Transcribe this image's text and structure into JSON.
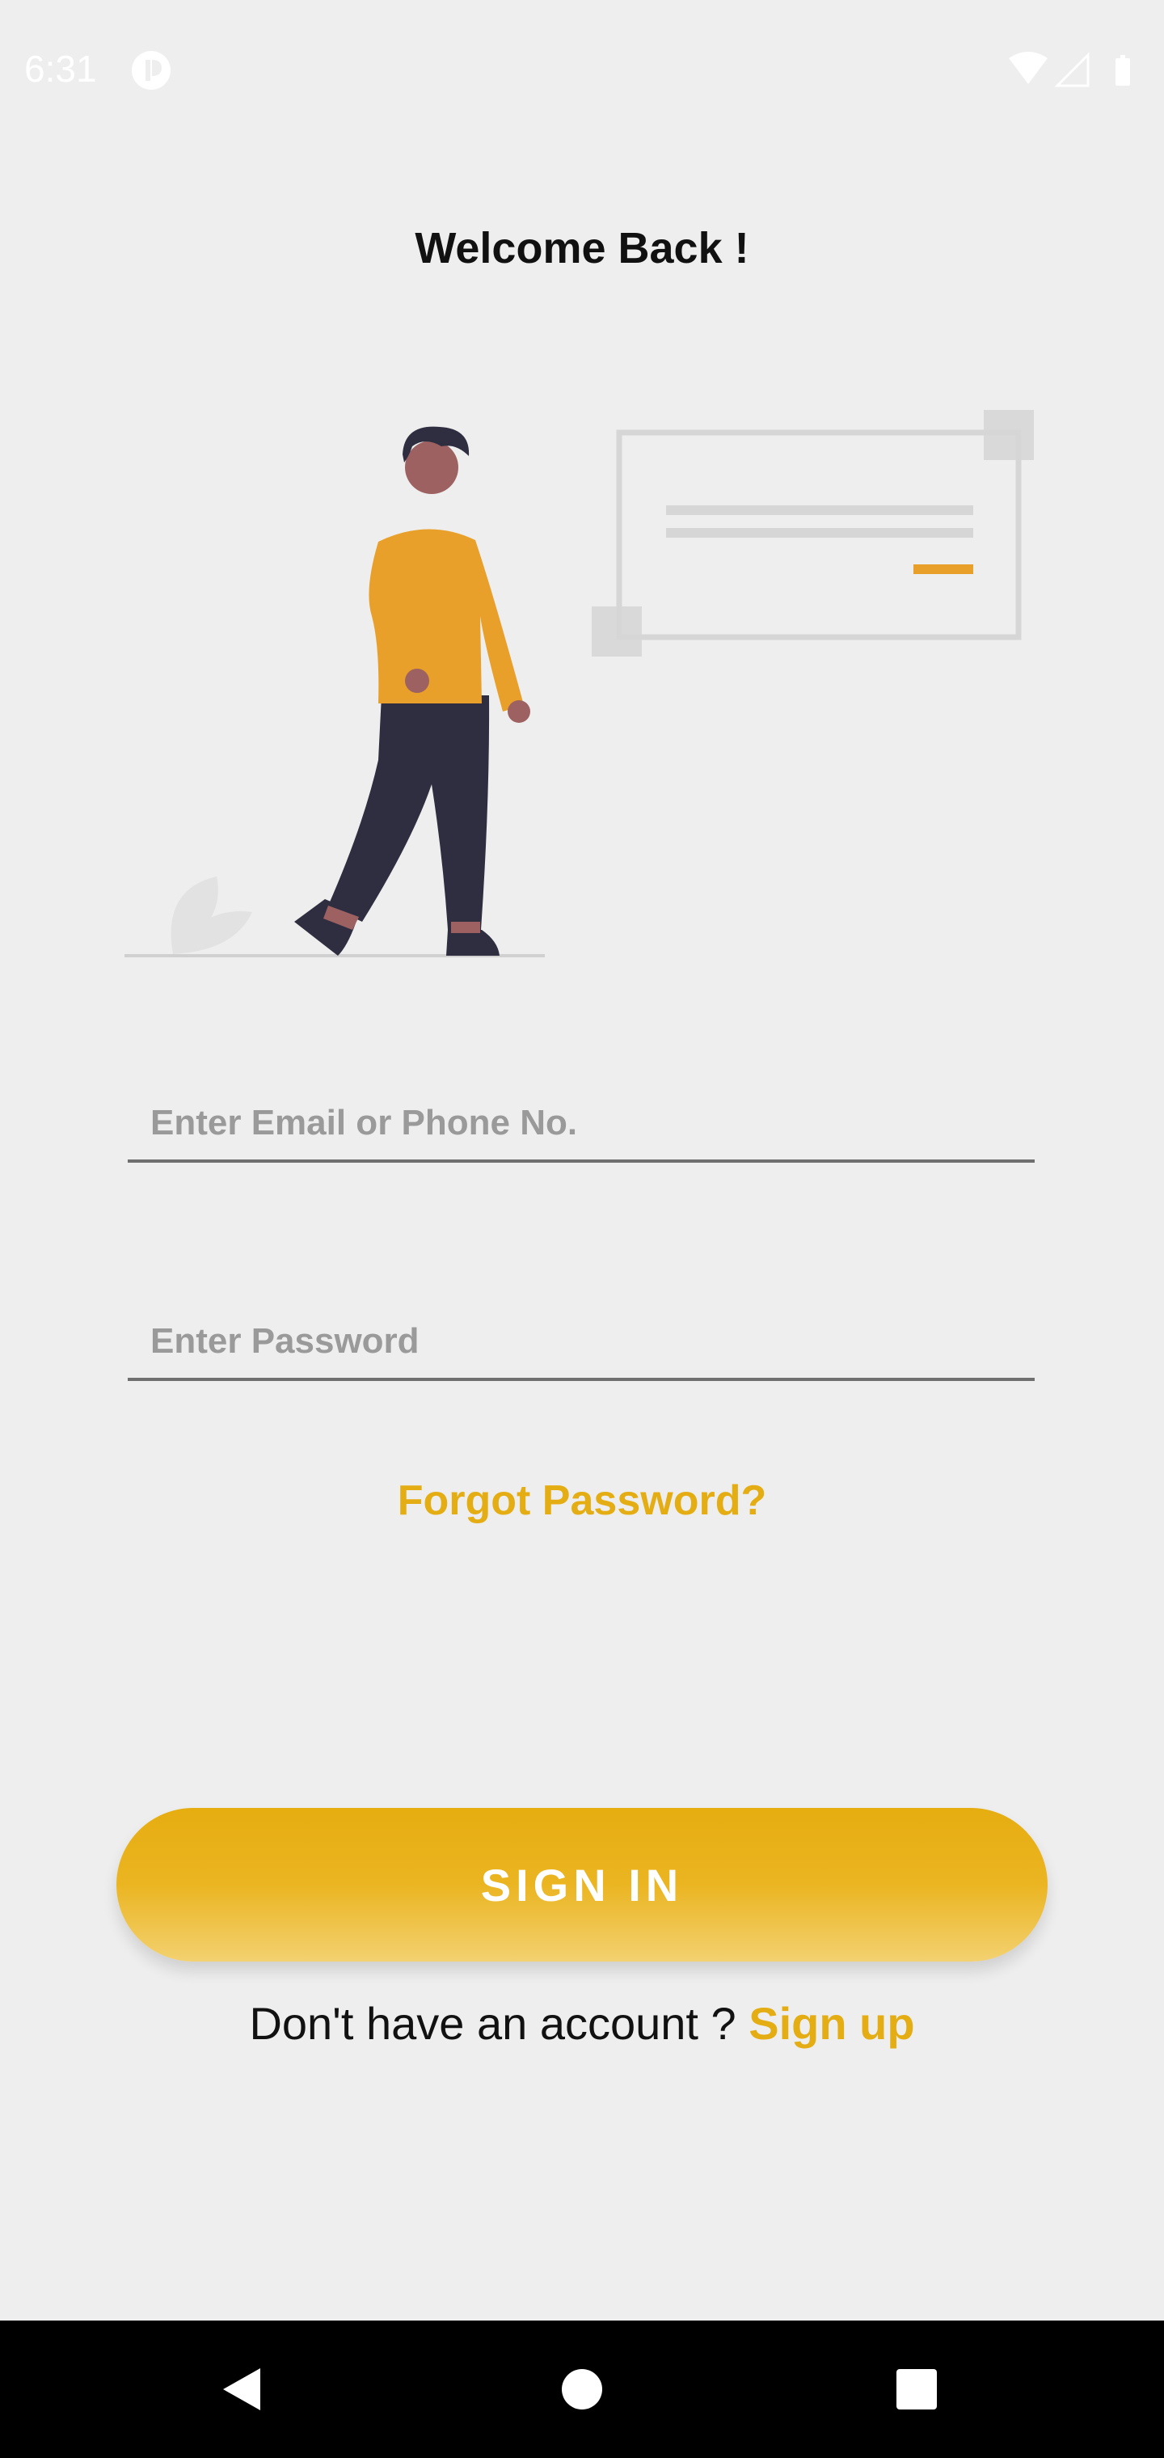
{
  "status_bar": {
    "time": "6:31",
    "icons": [
      "app-notification-icon",
      "wifi-icon",
      "cellular-signal-icon",
      "battery-icon"
    ]
  },
  "title": "Welcome Back !",
  "illustration": {
    "description_icon": "person-with-message-card-illustration",
    "colors": {
      "shirt": "#e8a02a",
      "pants": "#2f2e41",
      "skin": "#9e6161",
      "card": "#d6d6d6",
      "accent": "#e8a02a"
    }
  },
  "form": {
    "email": {
      "placeholder": "Enter Email or Phone No.",
      "value": ""
    },
    "password": {
      "placeholder": "Enter Password",
      "value": ""
    },
    "forgot_label": "Forgot Password?",
    "signin_label": "SIGN IN",
    "signup_prompt": "Don't have an account ? ",
    "signup_label": "Sign up"
  },
  "theme": {
    "accent": "#e5ad14",
    "background": "#eeeeee"
  },
  "nav_bar": {
    "buttons": [
      "back-icon",
      "home-icon",
      "recents-icon"
    ]
  }
}
